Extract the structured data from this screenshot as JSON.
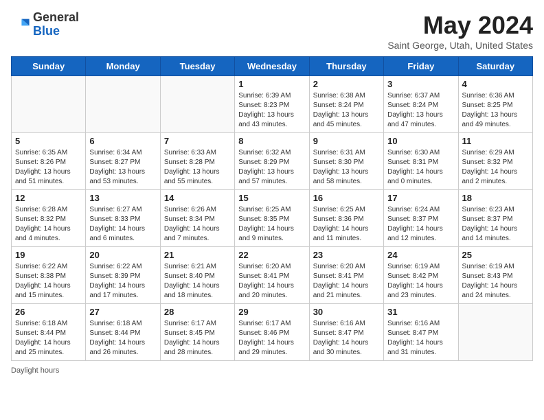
{
  "logo": {
    "general": "General",
    "blue": "Blue"
  },
  "header": {
    "month_year": "May 2024",
    "location": "Saint George, Utah, United States"
  },
  "days_of_week": [
    "Sunday",
    "Monday",
    "Tuesday",
    "Wednesday",
    "Thursday",
    "Friday",
    "Saturday"
  ],
  "weeks": [
    [
      {
        "day": "",
        "info": ""
      },
      {
        "day": "",
        "info": ""
      },
      {
        "day": "",
        "info": ""
      },
      {
        "day": "1",
        "info": "Sunrise: 6:39 AM\nSunset: 8:23 PM\nDaylight: 13 hours\nand 43 minutes."
      },
      {
        "day": "2",
        "info": "Sunrise: 6:38 AM\nSunset: 8:24 PM\nDaylight: 13 hours\nand 45 minutes."
      },
      {
        "day": "3",
        "info": "Sunrise: 6:37 AM\nSunset: 8:24 PM\nDaylight: 13 hours\nand 47 minutes."
      },
      {
        "day": "4",
        "info": "Sunrise: 6:36 AM\nSunset: 8:25 PM\nDaylight: 13 hours\nand 49 minutes."
      }
    ],
    [
      {
        "day": "5",
        "info": "Sunrise: 6:35 AM\nSunset: 8:26 PM\nDaylight: 13 hours\nand 51 minutes."
      },
      {
        "day": "6",
        "info": "Sunrise: 6:34 AM\nSunset: 8:27 PM\nDaylight: 13 hours\nand 53 minutes."
      },
      {
        "day": "7",
        "info": "Sunrise: 6:33 AM\nSunset: 8:28 PM\nDaylight: 13 hours\nand 55 minutes."
      },
      {
        "day": "8",
        "info": "Sunrise: 6:32 AM\nSunset: 8:29 PM\nDaylight: 13 hours\nand 57 minutes."
      },
      {
        "day": "9",
        "info": "Sunrise: 6:31 AM\nSunset: 8:30 PM\nDaylight: 13 hours\nand 58 minutes."
      },
      {
        "day": "10",
        "info": "Sunrise: 6:30 AM\nSunset: 8:31 PM\nDaylight: 14 hours\nand 0 minutes."
      },
      {
        "day": "11",
        "info": "Sunrise: 6:29 AM\nSunset: 8:32 PM\nDaylight: 14 hours\nand 2 minutes."
      }
    ],
    [
      {
        "day": "12",
        "info": "Sunrise: 6:28 AM\nSunset: 8:32 PM\nDaylight: 14 hours\nand 4 minutes."
      },
      {
        "day": "13",
        "info": "Sunrise: 6:27 AM\nSunset: 8:33 PM\nDaylight: 14 hours\nand 6 minutes."
      },
      {
        "day": "14",
        "info": "Sunrise: 6:26 AM\nSunset: 8:34 PM\nDaylight: 14 hours\nand 7 minutes."
      },
      {
        "day": "15",
        "info": "Sunrise: 6:25 AM\nSunset: 8:35 PM\nDaylight: 14 hours\nand 9 minutes."
      },
      {
        "day": "16",
        "info": "Sunrise: 6:25 AM\nSunset: 8:36 PM\nDaylight: 14 hours\nand 11 minutes."
      },
      {
        "day": "17",
        "info": "Sunrise: 6:24 AM\nSunset: 8:37 PM\nDaylight: 14 hours\nand 12 minutes."
      },
      {
        "day": "18",
        "info": "Sunrise: 6:23 AM\nSunset: 8:37 PM\nDaylight: 14 hours\nand 14 minutes."
      }
    ],
    [
      {
        "day": "19",
        "info": "Sunrise: 6:22 AM\nSunset: 8:38 PM\nDaylight: 14 hours\nand 15 minutes."
      },
      {
        "day": "20",
        "info": "Sunrise: 6:22 AM\nSunset: 8:39 PM\nDaylight: 14 hours\nand 17 minutes."
      },
      {
        "day": "21",
        "info": "Sunrise: 6:21 AM\nSunset: 8:40 PM\nDaylight: 14 hours\nand 18 minutes."
      },
      {
        "day": "22",
        "info": "Sunrise: 6:20 AM\nSunset: 8:41 PM\nDaylight: 14 hours\nand 20 minutes."
      },
      {
        "day": "23",
        "info": "Sunrise: 6:20 AM\nSunset: 8:41 PM\nDaylight: 14 hours\nand 21 minutes."
      },
      {
        "day": "24",
        "info": "Sunrise: 6:19 AM\nSunset: 8:42 PM\nDaylight: 14 hours\nand 23 minutes."
      },
      {
        "day": "25",
        "info": "Sunrise: 6:19 AM\nSunset: 8:43 PM\nDaylight: 14 hours\nand 24 minutes."
      }
    ],
    [
      {
        "day": "26",
        "info": "Sunrise: 6:18 AM\nSunset: 8:44 PM\nDaylight: 14 hours\nand 25 minutes."
      },
      {
        "day": "27",
        "info": "Sunrise: 6:18 AM\nSunset: 8:44 PM\nDaylight: 14 hours\nand 26 minutes."
      },
      {
        "day": "28",
        "info": "Sunrise: 6:17 AM\nSunset: 8:45 PM\nDaylight: 14 hours\nand 28 minutes."
      },
      {
        "day": "29",
        "info": "Sunrise: 6:17 AM\nSunset: 8:46 PM\nDaylight: 14 hours\nand 29 minutes."
      },
      {
        "day": "30",
        "info": "Sunrise: 6:16 AM\nSunset: 8:47 PM\nDaylight: 14 hours\nand 30 minutes."
      },
      {
        "day": "31",
        "info": "Sunrise: 6:16 AM\nSunset: 8:47 PM\nDaylight: 14 hours\nand 31 minutes."
      },
      {
        "day": "",
        "info": ""
      }
    ]
  ],
  "footer": {
    "daylight_label": "Daylight hours"
  }
}
